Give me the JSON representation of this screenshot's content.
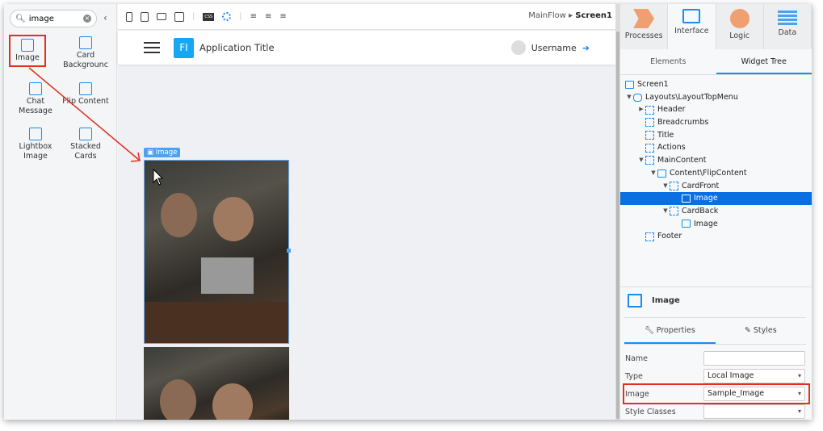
{
  "left_panel": {
    "search_value": "image",
    "widgets": [
      {
        "label": "Image",
        "icon": "image-icon"
      },
      {
        "label": "Card Backgrounc",
        "icon": "image-icon"
      },
      {
        "label": "Chat Message",
        "icon": "chat-icon"
      },
      {
        "label": "Flip Content",
        "icon": "flip-icon"
      },
      {
        "label": "Lightbox Image",
        "icon": "lightbox-icon"
      },
      {
        "label": "Stacked Cards",
        "icon": "stacked-cards-icon"
      }
    ]
  },
  "toolbar": {
    "css_label": "CSS",
    "breadcrumb_flow": "MainFlow",
    "breadcrumb_screen": "Screen1"
  },
  "canvas": {
    "app_logo": "FI",
    "app_title": "Application Title",
    "username": "Username",
    "image_tag": "Image"
  },
  "right_panel": {
    "tabs": [
      "Processes",
      "Interface",
      "Logic",
      "Data"
    ],
    "subtabs": [
      "Elements",
      "Widget Tree"
    ],
    "tree": [
      {
        "label": "Screen1",
        "depth": 0,
        "arrow": "",
        "kind": "screen"
      },
      {
        "label": "Layouts\\LayoutTopMenu",
        "depth": 0,
        "arrow": "▼",
        "kind": "layout"
      },
      {
        "label": "Header",
        "depth": 1,
        "arrow": "▶",
        "kind": "ph"
      },
      {
        "label": "Breadcrumbs",
        "depth": 1,
        "arrow": "",
        "kind": "ph"
      },
      {
        "label": "Title",
        "depth": 1,
        "arrow": "",
        "kind": "ph"
      },
      {
        "label": "Actions",
        "depth": 1,
        "arrow": "",
        "kind": "ph"
      },
      {
        "label": "MainContent",
        "depth": 1,
        "arrow": "▼",
        "kind": "ph"
      },
      {
        "label": "Content\\FlipContent",
        "depth": 2,
        "arrow": "▼",
        "kind": "flip"
      },
      {
        "label": "CardFront",
        "depth": 3,
        "arrow": "▼",
        "kind": "ph"
      },
      {
        "label": "Image",
        "depth": 4,
        "arrow": "",
        "kind": "img",
        "selected": true
      },
      {
        "label": "CardBack",
        "depth": 3,
        "arrow": "▼",
        "kind": "ph"
      },
      {
        "label": "Image",
        "depth": 4,
        "arrow": "",
        "kind": "img"
      },
      {
        "label": "Footer",
        "depth": 1,
        "arrow": "",
        "kind": "ph"
      }
    ],
    "properties": {
      "title": "Image",
      "tabs": [
        "Properties",
        "Styles"
      ],
      "fields": [
        {
          "label": "Name",
          "value": "",
          "dropdown": false
        },
        {
          "label": "Type",
          "value": "Local Image",
          "dropdown": true
        },
        {
          "label": "Image",
          "value": "Sample_Image",
          "dropdown": true,
          "highlighted": true
        },
        {
          "label": "Style Classes",
          "value": "",
          "dropdown": true
        }
      ]
    }
  },
  "colors": {
    "accent": "#1a8cf0",
    "highlight": "#e0301e",
    "selected": "#0a6fe0"
  }
}
